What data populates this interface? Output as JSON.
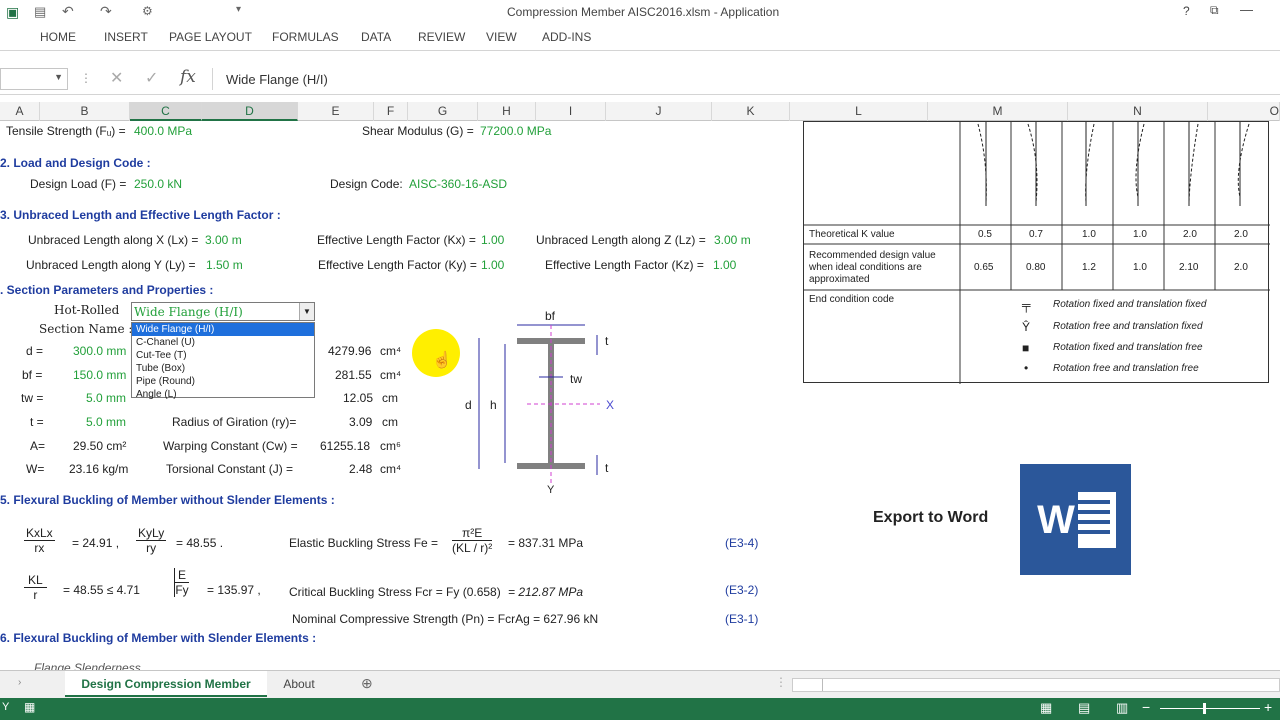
{
  "window": {
    "title": "Compression Member AISC2016.xlsm - Application",
    "help": "?"
  },
  "ribbon": {
    "file": "E",
    "tabs": [
      "HOME",
      "INSERT",
      "PAGE LAYOUT",
      "FORMULAS",
      "DATA",
      "REVIEW",
      "VIEW",
      "ADD-INS"
    ]
  },
  "formula_bar": {
    "fx": "fx",
    "value": "Wide Flange (H/I)"
  },
  "columns": [
    "A",
    "B",
    "C",
    "D",
    "E",
    "F",
    "G",
    "H",
    "I",
    "J",
    "K",
    "L",
    "M",
    "N",
    "O"
  ],
  "sheet": {
    "tensile": "Tensile Strength (Fᵤ) =",
    "tensile_val": "400.0 MPa",
    "shear": "Shear Modulus (G) =",
    "shear_val": "77200.0 MPa",
    "sec2": "2. Load and Design Code :",
    "load": "Design Load (F) =",
    "load_val": "250.0 kN",
    "code": "Design Code:",
    "code_val": "AISC-360-16-ASD",
    "sec3": "3. Unbraced Length and Effective Length Factor :",
    "lx": "Unbraced Length along X (Lx) =",
    "lx_val": "3.00 m",
    "kx": "Effective Length Factor (Kx) =",
    "kx_val": "1.00",
    "lz": "Unbraced Length along Z  (Lz) =",
    "lz_val": "3.00 m",
    "ly": "Unbraced Length along Y (Ly) =",
    "ly_val": "1.50 m",
    "ky": "Effective Length Factor (Ky) =",
    "ky_val": "1.00",
    "kz": "Effective Length Factor (Kz) =",
    "kz_val": "1.00",
    "sec4": ". Section Parameters and Properties :",
    "hot": "Hot-Rolled",
    "secname": "Section Name :",
    "dropdown_value": "Wide Flange (H/I)",
    "options": [
      "Wide Flange (H/I)",
      "C-Chanel (U)",
      "Cut-Tee (T)",
      "Tube (Box)",
      "Pipe (Round)",
      "Angle (L)"
    ],
    "d": "d =",
    "d_val": "300.0 mm",
    "ix_val": "4279.96",
    "cm4": "cm⁴",
    "bf": "bf =",
    "bf_val": "150.0 mm",
    "iy_val": "281.55",
    "tw": "tw =",
    "tw_val": "5.0 mm",
    "rx_val": "12.05",
    "cm": "cm",
    "t": "t =",
    "t_val": "5.0 mm",
    "ry": "Radius of Giration (ry)=",
    "ry_val": "3.09",
    "a": "A=",
    "a_val": "29.50 cm²",
    "cw": "Warping Constant (Cw) =",
    "cw_val": "61255.18",
    "cm6": "cm⁶",
    "w": "W=",
    "w_val": "23.16 kg/m",
    "j": "Torsional Constant (J) =",
    "j_val": "2.48",
    "sec5": "5. Flexural Buckling of Member without Slender Elements :",
    "r1": "=  24.91 ,",
    "r2": "=  48.55 .",
    "elastic": "Elastic Buckling Stress  Fe =",
    "fe_val": "=  837.31 MPa",
    "e34": "(E3-4)",
    "r3": "=  48.55   ≤  4.71",
    "r4": "=   135.97 ,",
    "critical": "Critical Buckling Stress  Fcr =  Fy (0.658)",
    "fcr_val": "=  212.87 MPa",
    "e32": "(E3-2)",
    "nominal": "Nominal Compressive Strength (Pn) = FcrAg = 627.96 kN",
    "e31": "(E3-1)",
    "sec6": "6. Flexural Buckling of Member with Slender Elements :",
    "flange": "Flange Slenderness"
  },
  "k_table": {
    "theoretical": "Theoretical K value",
    "k_vals": [
      "0.5",
      "0.7",
      "1.0",
      "1.0",
      "2.0",
      "2.0"
    ],
    "recommended": "Recommended design value when ideal conditions are approximated",
    "r_vals": [
      "0.65",
      "0.80",
      "1.2",
      "1.0",
      "2.10",
      "2.0"
    ],
    "end": "End condition code",
    "codes": [
      "Rotation fixed and translation fixed",
      "Rotation free and translation fixed",
      "Rotation fixed and translation free",
      "Rotation free and translation free"
    ]
  },
  "export": "Export to Word",
  "diagram": {
    "bf": "bf",
    "t": "t",
    "tw": "tw",
    "d": "d",
    "h": "h",
    "x": "X",
    "y": "Y"
  },
  "tabs": {
    "active": "Design Compression Member",
    "other": "About"
  },
  "status": {
    "ready": "Y"
  },
  "colors": {
    "excel_green": "#217346",
    "value_green": "#22a03a",
    "heading_blue": "#1f3c9f",
    "word_blue": "#2b579a"
  }
}
